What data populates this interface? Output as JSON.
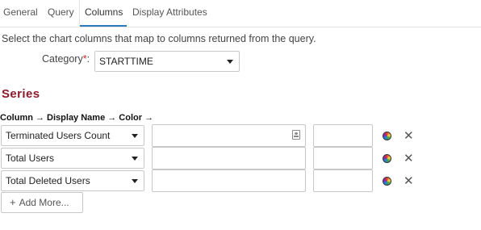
{
  "tabs": [
    {
      "label": "General"
    },
    {
      "label": "Query"
    },
    {
      "label": "Columns"
    },
    {
      "label": "Display Attributes"
    }
  ],
  "active_tab": "Columns",
  "intro_text": "Select the chart columns that map to columns returned from the query.",
  "category": {
    "label": "Category",
    "required_mark": "*",
    "suffix": ":",
    "value": "STARTTIME"
  },
  "series": {
    "title": "Series",
    "column_header": "Column → Display Name → Color →",
    "rows": [
      {
        "column": "Terminated Users Count",
        "display_name": "",
        "color": ""
      },
      {
        "column": "Total Users",
        "display_name": "",
        "color": ""
      },
      {
        "column": "Total Deleted Users",
        "display_name": "",
        "color": ""
      }
    ],
    "remove_glyph": "✕",
    "add_more": {
      "plus": "+",
      "label": "Add More..."
    }
  },
  "colors": {
    "accent": "#2b7bb9",
    "series_title": "#8b1a2b",
    "required": "#c62828"
  }
}
